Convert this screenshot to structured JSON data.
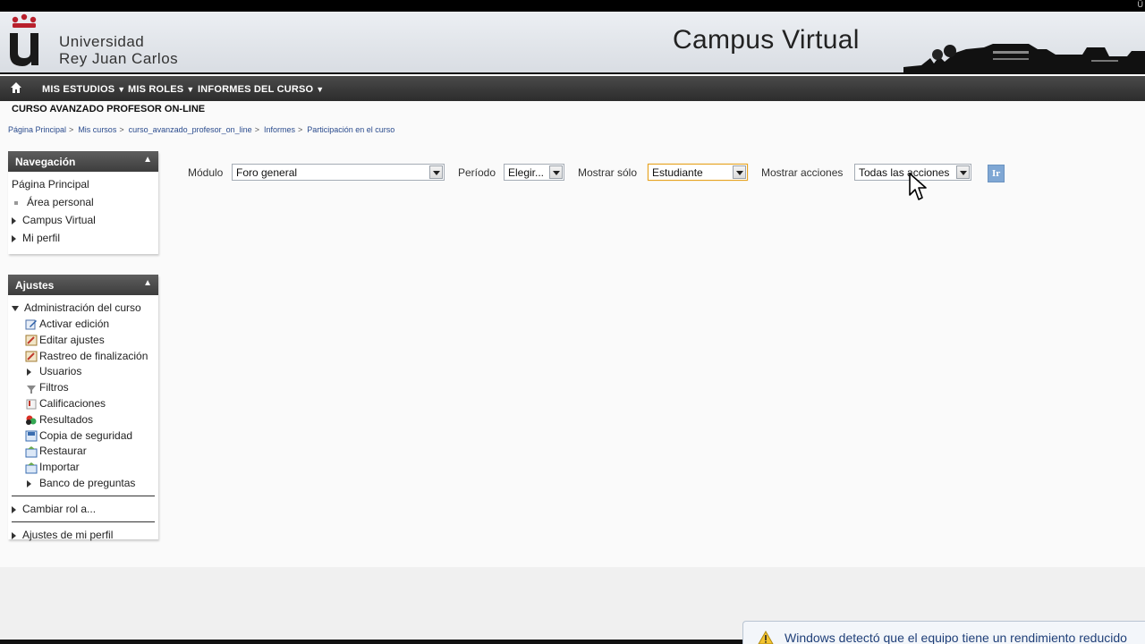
{
  "banner": {
    "university_line1": "Universidad",
    "university_line2": "Rey Juan Carlos",
    "title": "Campus Virtual",
    "brand_color": "#b8202c"
  },
  "navbar": {
    "items": [
      {
        "label": "MIS ESTUDIOS"
      },
      {
        "label": "MIS ROLES"
      },
      {
        "label": "INFORMES DEL CURSO"
      }
    ],
    "home_icon": "home-icon"
  },
  "course": {
    "title": "CURSO AVANZADO PROFESOR ON-LINE"
  },
  "breadcrumb": {
    "items": [
      "Página Principal",
      "Mis cursos",
      "curso_avanzado_profesor_on_line",
      "Informes",
      "Participación en el curso"
    ],
    "separator": ">"
  },
  "navigation_block": {
    "title": "Navegación",
    "items": [
      {
        "label": "Página Principal"
      },
      {
        "label": "Área personal"
      },
      {
        "label": "Campus Virtual"
      },
      {
        "label": "Mi perfil"
      }
    ]
  },
  "settings_block": {
    "title": "Ajustes",
    "admin_label": "Administración del curso",
    "admin_items": [
      {
        "label": "Activar edición",
        "icon": "edit-icon"
      },
      {
        "label": "Editar ajustes",
        "icon": "settings-icon"
      },
      {
        "label": "Rastreo de finalización",
        "icon": "settings-icon"
      },
      {
        "label": "Usuarios",
        "icon": "expand-icon"
      },
      {
        "label": "Filtros",
        "icon": "filter-icon"
      },
      {
        "label": "Calificaciones",
        "icon": "grades-icon"
      },
      {
        "label": "Resultados",
        "icon": "outcomes-icon"
      },
      {
        "label": "Copia de seguridad",
        "icon": "backup-icon"
      },
      {
        "label": "Restaurar",
        "icon": "restore-icon"
      },
      {
        "label": "Importar",
        "icon": "import-icon"
      },
      {
        "label": "Banco de preguntas",
        "icon": "expand-icon"
      }
    ],
    "switch_role_label": "Cambiar rol a...",
    "profile_settings_label": "Ajustes de mi perfil"
  },
  "filters": {
    "module_label": "Módulo",
    "module_value": "Foro general",
    "period_label": "Período",
    "period_value": "Elegir...",
    "show_only_label": "Mostrar sólo",
    "show_only_value": "Estudiante",
    "show_actions_label": "Mostrar acciones",
    "show_actions_value": "Todas las acciones",
    "go_label": "Ir"
  },
  "notification": {
    "text": "Windows detectó que el equipo tiene un rendimiento reducido"
  }
}
